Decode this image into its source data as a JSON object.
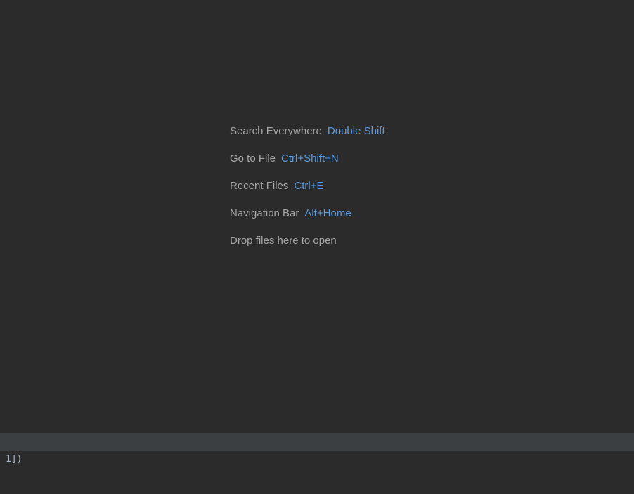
{
  "empty_editor": {
    "hints": [
      {
        "label": "Search Everywhere",
        "shortcut": "Double Shift"
      },
      {
        "label": "Go to File",
        "shortcut": "Ctrl+Shift+N"
      },
      {
        "label": "Recent Files",
        "shortcut": "Ctrl+E"
      },
      {
        "label": "Navigation Bar",
        "shortcut": "Alt+Home"
      },
      {
        "label": "Drop files here to open",
        "shortcut": ""
      }
    ]
  },
  "console": {
    "line": "1])"
  },
  "colors": {
    "background": "#2b2b2b",
    "hint_text": "#a6a6a6",
    "shortcut_text": "#5a9be0",
    "bar": "#3c3f41"
  }
}
